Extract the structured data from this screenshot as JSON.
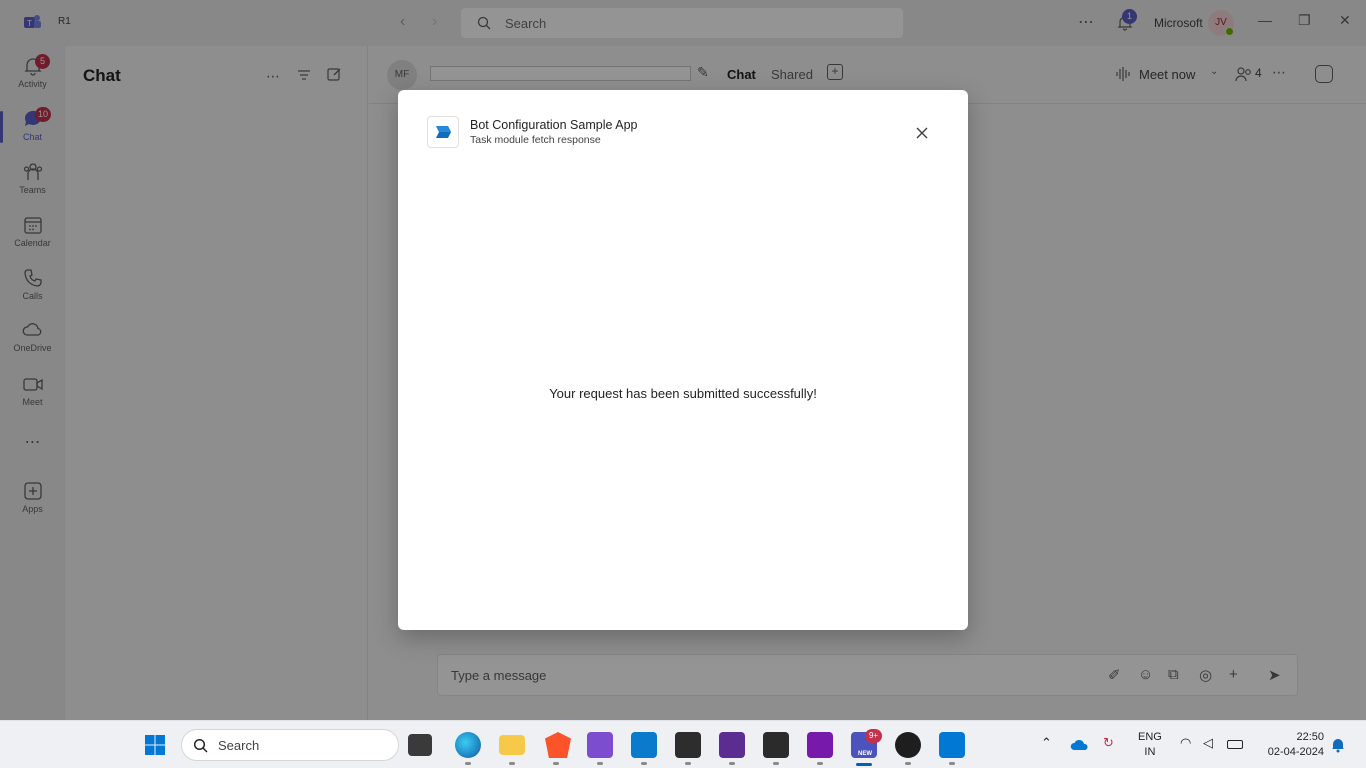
{
  "titlebar": {
    "tenant_label": "R1",
    "search_placeholder": "Search",
    "notification_count": "1",
    "org_name": "Microsoft",
    "avatar_initials": "JV"
  },
  "rail": {
    "items": [
      {
        "label": "Activity",
        "badge": "5"
      },
      {
        "label": "Chat",
        "badge": "10"
      },
      {
        "label": "Teams",
        "badge": ""
      },
      {
        "label": "Calendar",
        "badge": ""
      },
      {
        "label": "Calls",
        "badge": ""
      },
      {
        "label": "OneDrive",
        "badge": ""
      },
      {
        "label": "Meet",
        "badge": ""
      },
      {
        "label": "Apps",
        "badge": ""
      }
    ]
  },
  "chatlist": {
    "title": "Chat"
  },
  "chat_header": {
    "avatar_initials": "MF",
    "tabs": [
      "Chat",
      "Shared"
    ],
    "meet_label": "Meet now",
    "participant_count": "4"
  },
  "composer": {
    "placeholder": "Type a message"
  },
  "dialog": {
    "app_name": "Bot Configuration Sample App",
    "subtitle": "Task module fetch response",
    "message": "Your request has been submitted successfully!"
  },
  "taskbar": {
    "search_label": "Search",
    "teams_badge": "9+",
    "teams_new_label": "NEW",
    "lang_top": "ENG",
    "lang_bottom": "IN",
    "time": "22:50",
    "date": "02-04-2024"
  },
  "colors": {
    "accent": "#5b5fc7",
    "badge": "#c4314b",
    "overlay": "rgba(0,0,0,0.42)"
  }
}
